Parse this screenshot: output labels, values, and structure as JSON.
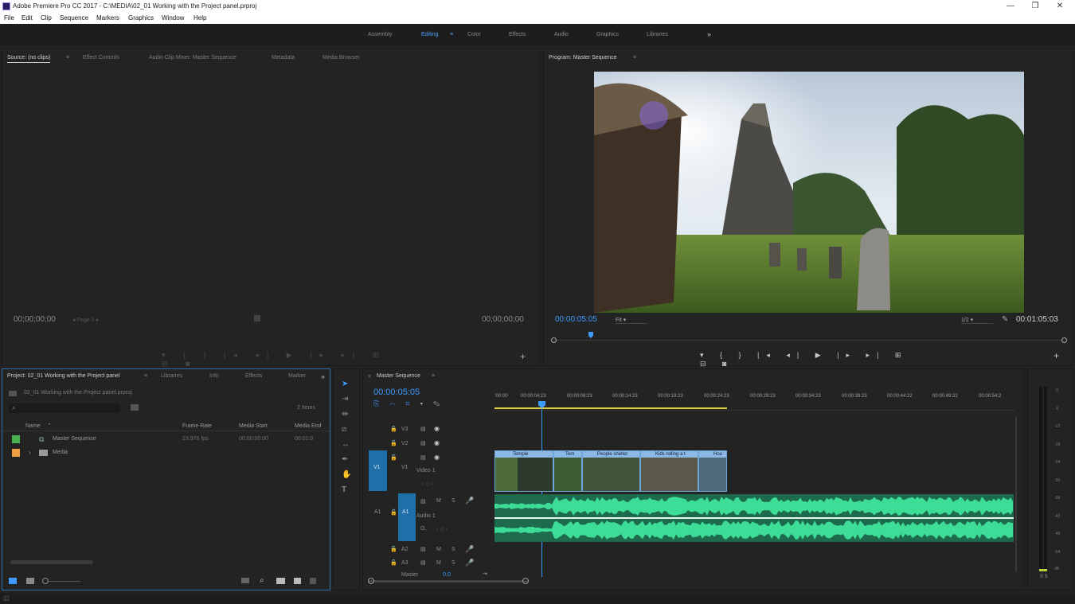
{
  "window": {
    "title": "Adobe Premiere Pro CC 2017 - C:\\MEDIA\\02_01 Working with the Project panel.prproj",
    "minimize": "—",
    "maximize": "❐",
    "close": "✕"
  },
  "menu": [
    "File",
    "Edit",
    "Clip",
    "Sequence",
    "Markers",
    "Graphics",
    "Window",
    "Help"
  ],
  "workspaces": {
    "tabs": [
      "Assembly",
      "Editing",
      "Color",
      "Effects",
      "Audio",
      "Graphics",
      "Libraries"
    ],
    "active": "Editing",
    "more": "»",
    "menu_glyph": "≡"
  },
  "source_panel": {
    "tabs": [
      "Source: (no clips)",
      "Effect Controls",
      "Audio Clip Mixer: Master Sequence",
      "Metadata",
      "Media Browser"
    ],
    "menu_glyph": "≡",
    "timecode_in": "00;00;00;00",
    "timecode_out": "00;00;00;00",
    "page": "Page 1"
  },
  "program_panel": {
    "title": "Program: Master Sequence",
    "menu_glyph": "≡",
    "timecode": "00:00:05:05",
    "fit": "Fit",
    "resolution": "1/2",
    "duration": "00:01:05:03"
  },
  "project_panel": {
    "tabs": [
      "Project: 02_01 Working with the Project panel",
      "Libraries",
      "Info",
      "Effects",
      "Marker"
    ],
    "menu_glyph": "≡",
    "more": "»",
    "file": "02_01 Working with the Project panel.prproj",
    "item_count": "2 Items",
    "columns": [
      "Name",
      "Frame Rate",
      "Media Start",
      "Media End"
    ],
    "items": [
      {
        "name": "Master Sequence",
        "frame_rate": "23.976 fps",
        "media_start": "00:00:00:00",
        "media_end": "00:01:0",
        "color": "#4caf50"
      },
      {
        "name": "Media",
        "frame_rate": "",
        "media_start": "",
        "media_end": "",
        "color": "#f0a040"
      }
    ]
  },
  "timeline": {
    "title": "Master Sequence",
    "menu_glyph": "≡",
    "timecode": "00:00:05:05",
    "ruler": [
      ":00:00",
      "00:00:04:23",
      "00:00:09:23",
      "00:00:14:23",
      "00:00:19:23",
      "00:00:24:23",
      "00:00:29:23",
      "00:00:34:23",
      "00:00:39:23",
      "00:00:44:22",
      "00:00:49:22",
      "00:00:54:2"
    ],
    "tracks": {
      "v3": "V3",
      "v2": "V2",
      "v1": "V1",
      "video1": "Video 1",
      "a1": "A1",
      "audio1": "Audio 1",
      "a2": "A2",
      "a3": "A3",
      "master": "Master",
      "master_val": "0.0",
      "src_v1": "V1",
      "src_a1": "A1",
      "m": "M",
      "s": "S",
      "fx": "O,"
    },
    "clips": [
      "Temple",
      "Tem",
      "People shelter",
      "Kids rolling a t",
      "Hou"
    ]
  },
  "meter": {
    "scale": [
      "0",
      "-6",
      "-12",
      "-18",
      "-24",
      "-30",
      "-36",
      "-42",
      "-48",
      "-54",
      "dB"
    ],
    "solo": "S S"
  },
  "colors": {
    "accent_blue": "#3d9bff",
    "clip_blue": "#8cb8e6",
    "audio_green": "#3ddc97",
    "track_select": "#1f6fa8"
  }
}
